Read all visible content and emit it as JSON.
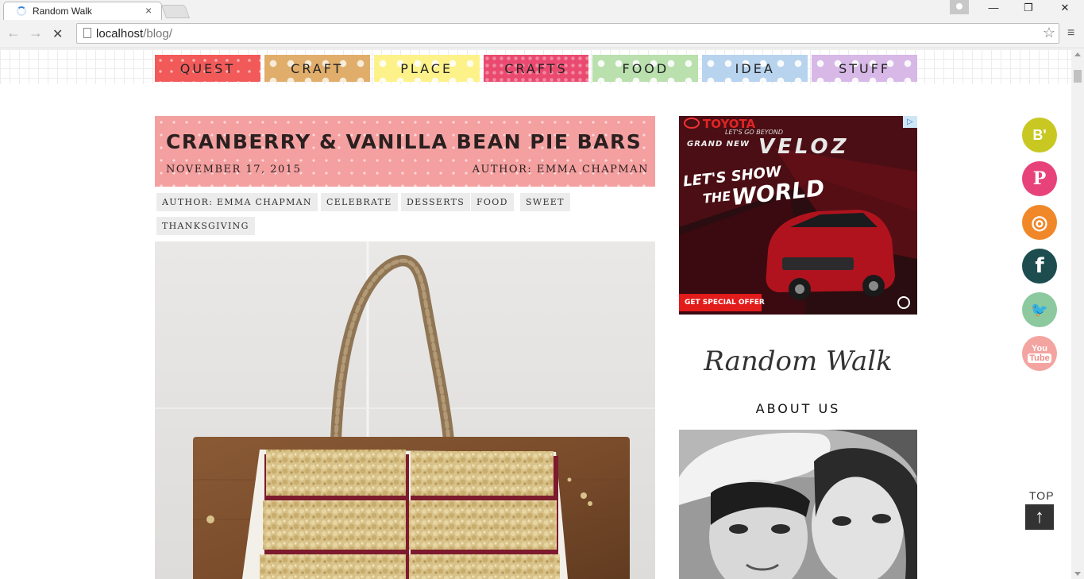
{
  "browser": {
    "tab_title": "Random Walk",
    "tab_close": "×",
    "url_host": "localhost",
    "url_path": "/blog/",
    "back": "←",
    "forward": "→",
    "stop": "✕",
    "star": "☆",
    "menu": "≡",
    "minimize": "—",
    "restore": "❐",
    "close": "✕"
  },
  "nav": {
    "items": [
      {
        "label": "QUEST"
      },
      {
        "label": "CRAFT"
      },
      {
        "label": "PLACE"
      },
      {
        "label": "CRAFTS"
      },
      {
        "label": "FOOD"
      },
      {
        "label": "IDEA"
      },
      {
        "label": "STUFF"
      }
    ]
  },
  "post": {
    "title": "CRANBERRY & VANILLA BEAN PIE BARS",
    "date": "NOVEMBER 17, 2015",
    "author": "AUTHOR: EMMA CHAPMAN",
    "tags": [
      "AUTHOR: EMMA CHAPMAN",
      "CELEBRATE",
      "DESSERTS",
      "FOOD",
      "SWEET",
      "THANKSGIVING"
    ]
  },
  "ad": {
    "brand": "TOYOTA",
    "tagline": "LET'S GO BEYOND",
    "model_prefix": "GRAND NEW",
    "model": "VELOZ",
    "headline_1": "LET'S SHOW",
    "headline_2a": "THE",
    "headline_2b": "WORLD",
    "cta": "GET SPECIAL OFFER",
    "badge": "▷"
  },
  "sidebar": {
    "script_title": "Random Walk",
    "about_title": "ABOUT US"
  },
  "social": {
    "hatena": "B'",
    "pinterest": "P",
    "instagram": "◎",
    "facebook": "f",
    "twitter": "🐦",
    "youtube_1": "You",
    "youtube_2": "Tube",
    "colors": {
      "hatena": "#c9c823",
      "pinterest": "#e8427a",
      "instagram": "#f0882a",
      "facebook": "#1d4d4f",
      "twitter": "#8cc99f",
      "youtube": "#f4a4a0"
    }
  },
  "back_to_top": {
    "label": "TOP",
    "arrow": "↑"
  }
}
